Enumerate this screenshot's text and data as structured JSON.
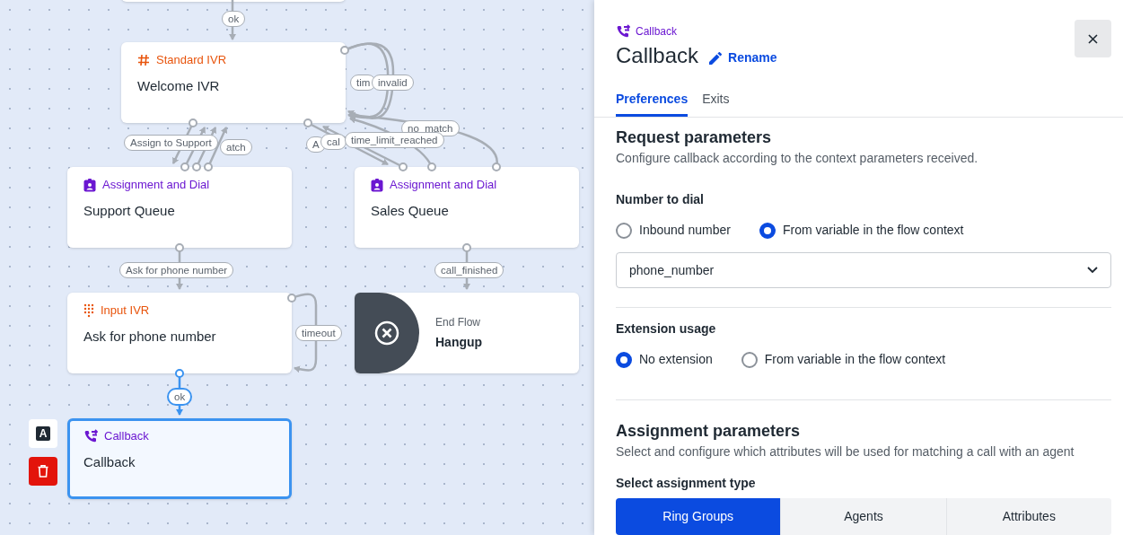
{
  "canvas": {
    "nodes": [
      {
        "kind": "partial"
      },
      {
        "kind": "standard_ivr",
        "type_label": "Standard IVR",
        "title": "Welcome IVR",
        "selected": false
      },
      {
        "kind": "assignment",
        "type_label": "Assignment and Dial",
        "title": "Support Queue",
        "selected": false
      },
      {
        "kind": "assignment",
        "type_label": "Assignment and Dial",
        "title": "Sales Queue",
        "selected": false
      },
      {
        "kind": "input_ivr",
        "type_label": "Input IVR",
        "title": "Ask for phone number",
        "selected": false
      },
      {
        "kind": "end",
        "type_label": "End Flow",
        "title": "Hangup",
        "selected": false
      },
      {
        "kind": "callback",
        "type_label": "Callback",
        "title": "Callback",
        "selected": true
      }
    ],
    "edge_labels": [
      {
        "text": "ok",
        "highlighted": false
      },
      {
        "text": "tim",
        "highlighted": false
      },
      {
        "text": "invalid",
        "highlighted": false
      },
      {
        "text": "Assign to Support",
        "highlighted": false
      },
      {
        "text": "atch",
        "highlighted": false
      },
      {
        "text": "A",
        "highlighted": false
      },
      {
        "text": "cal",
        "highlighted": false
      },
      {
        "text": "no_match",
        "highlighted": false
      },
      {
        "text": "time_limit_reached",
        "highlighted": false
      },
      {
        "text": "Ask for phone number",
        "highlighted": false
      },
      {
        "text": "call_finished",
        "highlighted": false
      },
      {
        "text": "timeout",
        "highlighted": false
      },
      {
        "text": "ok",
        "highlighted": true
      }
    ],
    "node_toolbar": {
      "label_button": "A"
    }
  },
  "panel": {
    "type_label": "Callback",
    "title": "Callback",
    "rename": "Rename",
    "tabs": [
      {
        "label": "Preferences",
        "selected": true
      },
      {
        "label": "Exits",
        "selected": false
      }
    ],
    "request": {
      "heading": "Request parameters",
      "description": "Configure callback according to the context parameters received.",
      "number_to_dial": {
        "label": "Number to dial",
        "options": [
          {
            "label": "Inbound number",
            "selected": false
          },
          {
            "label": "From variable in the flow context",
            "selected": true
          }
        ]
      },
      "variable": {
        "value": "phone_number"
      },
      "extension_usage": {
        "label": "Extension usage",
        "options": [
          {
            "label": "No extension",
            "selected": true
          },
          {
            "label": "From variable in the flow context",
            "selected": false
          }
        ]
      }
    },
    "assignment": {
      "heading": "Assignment parameters",
      "description": "Select and configure which attributes will be used for matching a call with an agent",
      "type_label": "Select assignment type",
      "types": [
        {
          "label": "Ring Groups",
          "selected": true
        },
        {
          "label": "Agents",
          "selected": false
        },
        {
          "label": "Attributes",
          "selected": false
        }
      ]
    }
  }
}
